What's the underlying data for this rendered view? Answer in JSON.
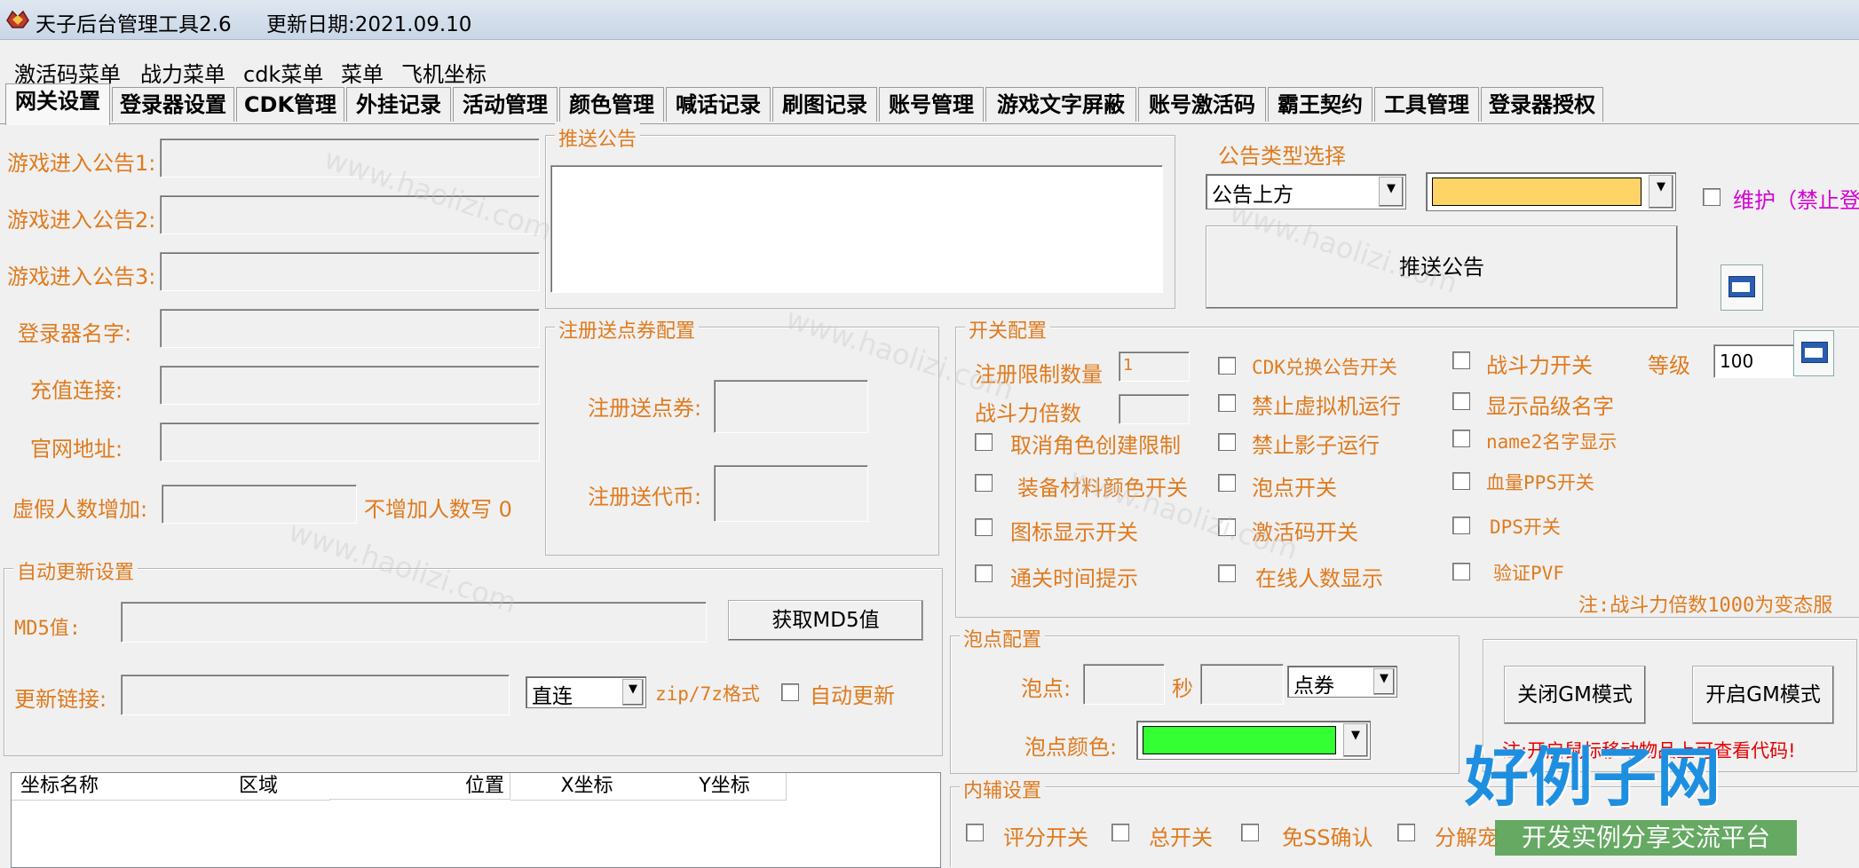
{
  "titlebar": {
    "app_title": "天子后台管理工具2.6",
    "update_date": "更新日期:2021.09.10"
  },
  "menu": [
    "激活码菜单",
    "战力菜单",
    "cdk菜单",
    "菜单",
    "飞机坐标"
  ],
  "tabs": [
    "网关设置",
    "登录器设置",
    "CDK管理",
    "外挂记录",
    "活动管理",
    "颜色管理",
    "喊话记录",
    "刷图记录",
    "账号管理",
    "游戏文字屏蔽",
    "账号激活码",
    "霸王契约",
    "工具管理",
    "登录器授权"
  ],
  "gateway_form": {
    "notice1": "游戏进入公告1:",
    "notice2": "游戏进入公告2:",
    "notice3": "游戏进入公告3:",
    "launcher_name": "登录器名字:",
    "recharge_link": "充值连接:",
    "official_site": "官网地址:",
    "fake_count": "虚假人数增加:",
    "fake_count_hint": "不增加人数写 0"
  },
  "push_notice": {
    "caption": "推送公告",
    "button": "推送公告"
  },
  "notice_type": {
    "caption": "公告类型选择",
    "selected": "公告上方",
    "color": "#FFD466",
    "maintain_label": "维护（禁止登"
  },
  "register_points": {
    "caption": "注册送点券配置",
    "points_label": "注册送点券:",
    "coins_label": "注册送代币:"
  },
  "switches": {
    "caption": "开关配置",
    "register_limit": "注册限制数量",
    "register_limit_value": "1",
    "power_multiplier": "战斗力倍数",
    "level_label": "等级",
    "level_value": "100",
    "col1": [
      "取消角色创建限制",
      "装备材料颜色开关",
      "图标显示开关",
      "通关时间提示"
    ],
    "col2": [
      "CDK兑换公告开关",
      "禁止虚拟机运行",
      "禁止影子运行",
      "泡点开关",
      "激活码开关",
      "在线人数显示"
    ],
    "col3": [
      "战斗力开关",
      "显示品级名字",
      "name2名字显示",
      "血量PPS开关",
      "DPS开关",
      "验证PVF"
    ],
    "note": "注:战斗力倍数1000为变态服"
  },
  "auto_update": {
    "caption": "自动更新设置",
    "md5_label": "MD5值:",
    "md5_button": "获取MD5值",
    "link_label": "更新链接:",
    "link_mode": "直连",
    "format_hint": "zip/7z格式",
    "auto_update_label": "自动更新"
  },
  "bubble": {
    "caption": "泡点配置",
    "point_label": "泡点:",
    "seconds": "秒",
    "currency": "点券",
    "color_label": "泡点颜色:",
    "color": "#33FF33"
  },
  "gm": {
    "close_button": "关闭GM模式",
    "open_button": "开启GM模式",
    "note": "注:开启鼠标移动物品上可查看代码!"
  },
  "coords_table": {
    "columns": [
      "坐标名称",
      "区域",
      "位置",
      "X坐标",
      "Y坐标"
    ]
  },
  "inner_assist": {
    "caption": "内辅设置",
    "items": [
      "评分开关",
      "总开关",
      "免SS确认",
      "分解宠"
    ]
  },
  "overlay": {
    "logo": "好例子网",
    "slogan": "开发实例分享交流平台",
    "watermark": "www.haolizi.com"
  }
}
